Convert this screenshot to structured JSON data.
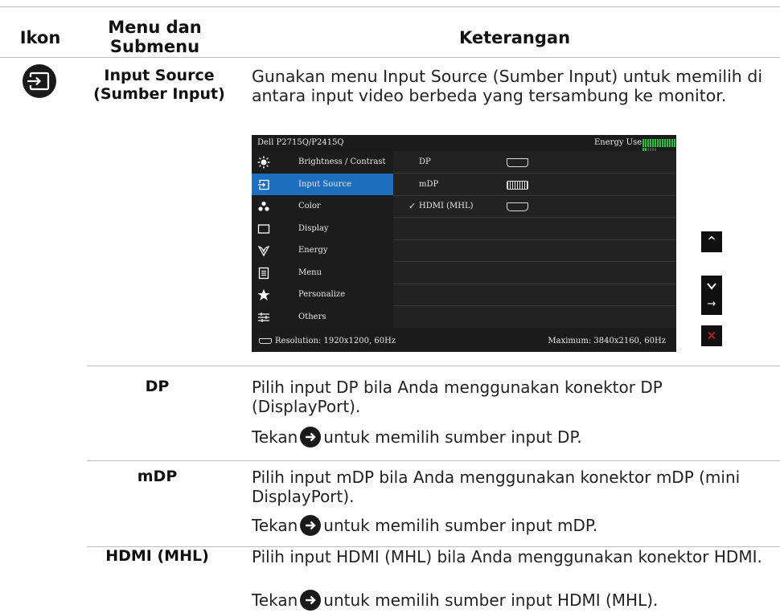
{
  "table": {
    "headers": {
      "icon": "Ikon",
      "menu": "Menu dan\nSubmenu",
      "description": "Keterangan"
    },
    "main_row": {
      "menu_label": "Input Source\n(Sumber Input)",
      "description": "Gunakan menu Input Source (Sumber Input) untuk memilih di antara input video berbeda yang tersambung ke monitor."
    },
    "sub_rows": [
      {
        "label": "DP",
        "line1": "Pilih input DP bila Anda menggunakan konektor DP (DisplayPort).",
        "press_before": "Tekan",
        "press_after": "untuk memilih sumber input DP."
      },
      {
        "label": "mDP",
        "line1": "Pilih input mDP bila Anda menggunakan konektor mDP (mini DisplayPort).",
        "press_before": "Tekan",
        "press_after": "untuk memilih sumber input mDP."
      },
      {
        "label": "HDMI (MHL)",
        "line1": "Pilih input HDMI (MHL) bila Anda menggunakan konektor HDMI.",
        "press_before": "Tekan",
        "press_after": "untuk memilih sumber input HDMI (MHL)."
      }
    ]
  },
  "osd": {
    "model": "Dell P2715Q/P2415Q",
    "energy_label": "Energy Use",
    "energy_level": 0.78,
    "menu_items": [
      {
        "label": "Brightness / Contrast",
        "icon": "brightness-icon",
        "selected": false
      },
      {
        "label": "Input Source",
        "icon": "input-source-icon",
        "selected": true
      },
      {
        "label": "Color",
        "icon": "color-icon",
        "selected": false
      },
      {
        "label": "Display",
        "icon": "display-icon",
        "selected": false
      },
      {
        "label": "Energy",
        "icon": "energy-icon",
        "selected": false
      },
      {
        "label": "Menu",
        "icon": "menu-icon",
        "selected": false
      },
      {
        "label": "Personalize",
        "icon": "star-icon",
        "selected": false
      },
      {
        "label": "Others",
        "icon": "others-icon",
        "selected": false
      }
    ],
    "inputs": [
      {
        "label": "DP",
        "checked": false,
        "port_icon": "dp-port-icon"
      },
      {
        "label": "mDP",
        "checked": false,
        "port_icon": "mdp-port-icon"
      },
      {
        "label": "HDMI (MHL)",
        "checked": true,
        "port_icon": "hdmi-port-icon"
      }
    ],
    "check_mark": "✓",
    "resolution": "Resolution: 1920x1200, 60Hz",
    "maximum": "Maximum: 3840x2160, 60Hz"
  },
  "side_buttons": [
    {
      "name": "up-button",
      "glyph": "^"
    },
    {
      "name": "down-button",
      "glyph": "v"
    },
    {
      "name": "right-button",
      "glyph": "→"
    },
    {
      "name": "close-button",
      "glyph": "✕"
    }
  ],
  "colors": {
    "selected": "#1d6fbd",
    "energy_on": "#28c33a",
    "close": "#e02020"
  }
}
